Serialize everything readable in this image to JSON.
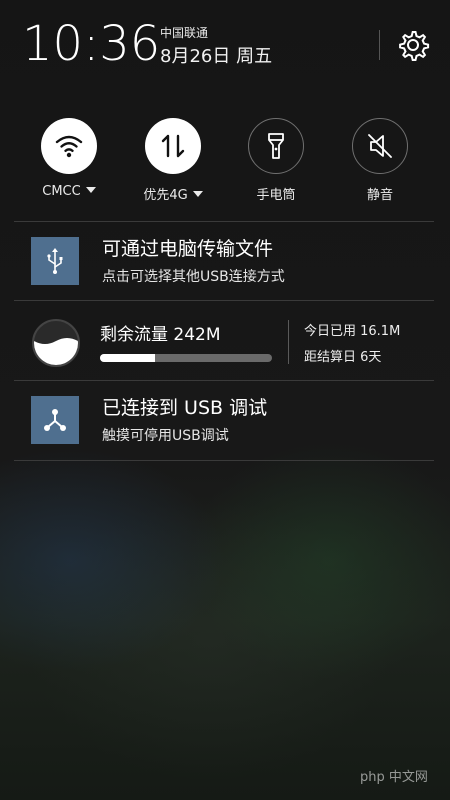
{
  "header": {
    "time": "10:36",
    "carrier": "中国联通",
    "date": "8月26日 周五"
  },
  "toggles": [
    {
      "label": "CMCC",
      "icon": "wifi-icon",
      "state": "on",
      "dropdown": true
    },
    {
      "label": "优先4G",
      "icon": "mobile-data-icon",
      "state": "on",
      "dropdown": true
    },
    {
      "label": "手电筒",
      "icon": "flashlight-icon",
      "state": "off",
      "dropdown": false
    },
    {
      "label": "静音",
      "icon": "mute-icon",
      "state": "off",
      "dropdown": false
    }
  ],
  "notifications": {
    "usb_transfer": {
      "title": "可通过电脑传输文件",
      "text": "点击可选择其他USB连接方式",
      "icon": "usb-icon"
    },
    "data_usage": {
      "title": "剩余流量 242M",
      "progress_percent": 32,
      "used_today": "今日已用 16.1M",
      "days_to_reset": "距结算日 6天",
      "icon": "data-drop-icon"
    },
    "usb_debug": {
      "title": "已连接到 USB 调试",
      "text": "触摸可停用USB调试",
      "icon": "usb-debug-icon"
    }
  },
  "watermark": "php 中文网",
  "colors": {
    "notification_icon_bg": "#4f6f8f",
    "toggle_on_bg": "#ffffff",
    "progress_track": "#6a6a6a"
  }
}
